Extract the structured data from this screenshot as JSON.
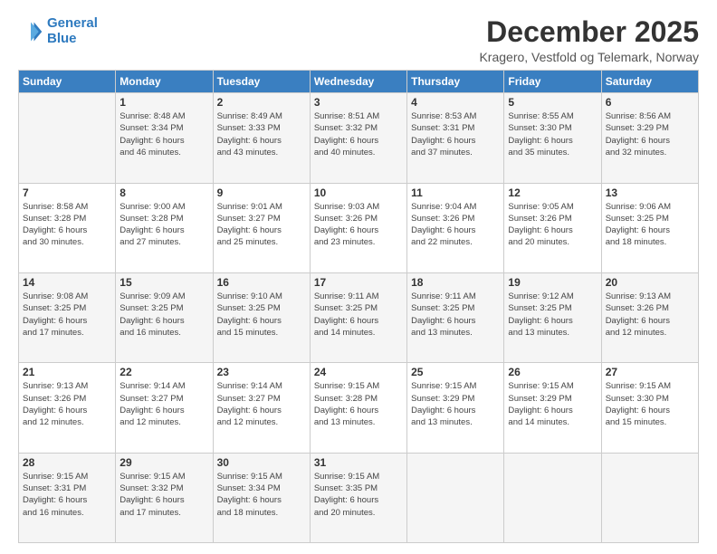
{
  "logo": {
    "line1": "General",
    "line2": "Blue"
  },
  "title": "December 2025",
  "subtitle": "Kragero, Vestfold og Telemark, Norway",
  "days_of_week": [
    "Sunday",
    "Monday",
    "Tuesday",
    "Wednesday",
    "Thursday",
    "Friday",
    "Saturday"
  ],
  "weeks": [
    [
      {
        "day": "",
        "info": ""
      },
      {
        "day": "1",
        "info": "Sunrise: 8:48 AM\nSunset: 3:34 PM\nDaylight: 6 hours\nand 46 minutes."
      },
      {
        "day": "2",
        "info": "Sunrise: 8:49 AM\nSunset: 3:33 PM\nDaylight: 6 hours\nand 43 minutes."
      },
      {
        "day": "3",
        "info": "Sunrise: 8:51 AM\nSunset: 3:32 PM\nDaylight: 6 hours\nand 40 minutes."
      },
      {
        "day": "4",
        "info": "Sunrise: 8:53 AM\nSunset: 3:31 PM\nDaylight: 6 hours\nand 37 minutes."
      },
      {
        "day": "5",
        "info": "Sunrise: 8:55 AM\nSunset: 3:30 PM\nDaylight: 6 hours\nand 35 minutes."
      },
      {
        "day": "6",
        "info": "Sunrise: 8:56 AM\nSunset: 3:29 PM\nDaylight: 6 hours\nand 32 minutes."
      }
    ],
    [
      {
        "day": "7",
        "info": "Sunrise: 8:58 AM\nSunset: 3:28 PM\nDaylight: 6 hours\nand 30 minutes."
      },
      {
        "day": "8",
        "info": "Sunrise: 9:00 AM\nSunset: 3:28 PM\nDaylight: 6 hours\nand 27 minutes."
      },
      {
        "day": "9",
        "info": "Sunrise: 9:01 AM\nSunset: 3:27 PM\nDaylight: 6 hours\nand 25 minutes."
      },
      {
        "day": "10",
        "info": "Sunrise: 9:03 AM\nSunset: 3:26 PM\nDaylight: 6 hours\nand 23 minutes."
      },
      {
        "day": "11",
        "info": "Sunrise: 9:04 AM\nSunset: 3:26 PM\nDaylight: 6 hours\nand 22 minutes."
      },
      {
        "day": "12",
        "info": "Sunrise: 9:05 AM\nSunset: 3:26 PM\nDaylight: 6 hours\nand 20 minutes."
      },
      {
        "day": "13",
        "info": "Sunrise: 9:06 AM\nSunset: 3:25 PM\nDaylight: 6 hours\nand 18 minutes."
      }
    ],
    [
      {
        "day": "14",
        "info": "Sunrise: 9:08 AM\nSunset: 3:25 PM\nDaylight: 6 hours\nand 17 minutes."
      },
      {
        "day": "15",
        "info": "Sunrise: 9:09 AM\nSunset: 3:25 PM\nDaylight: 6 hours\nand 16 minutes."
      },
      {
        "day": "16",
        "info": "Sunrise: 9:10 AM\nSunset: 3:25 PM\nDaylight: 6 hours\nand 15 minutes."
      },
      {
        "day": "17",
        "info": "Sunrise: 9:11 AM\nSunset: 3:25 PM\nDaylight: 6 hours\nand 14 minutes."
      },
      {
        "day": "18",
        "info": "Sunrise: 9:11 AM\nSunset: 3:25 PM\nDaylight: 6 hours\nand 13 minutes."
      },
      {
        "day": "19",
        "info": "Sunrise: 9:12 AM\nSunset: 3:25 PM\nDaylight: 6 hours\nand 13 minutes."
      },
      {
        "day": "20",
        "info": "Sunrise: 9:13 AM\nSunset: 3:26 PM\nDaylight: 6 hours\nand 12 minutes."
      }
    ],
    [
      {
        "day": "21",
        "info": "Sunrise: 9:13 AM\nSunset: 3:26 PM\nDaylight: 6 hours\nand 12 minutes."
      },
      {
        "day": "22",
        "info": "Sunrise: 9:14 AM\nSunset: 3:27 PM\nDaylight: 6 hours\nand 12 minutes."
      },
      {
        "day": "23",
        "info": "Sunrise: 9:14 AM\nSunset: 3:27 PM\nDaylight: 6 hours\nand 12 minutes."
      },
      {
        "day": "24",
        "info": "Sunrise: 9:15 AM\nSunset: 3:28 PM\nDaylight: 6 hours\nand 13 minutes."
      },
      {
        "day": "25",
        "info": "Sunrise: 9:15 AM\nSunset: 3:29 PM\nDaylight: 6 hours\nand 13 minutes."
      },
      {
        "day": "26",
        "info": "Sunrise: 9:15 AM\nSunset: 3:29 PM\nDaylight: 6 hours\nand 14 minutes."
      },
      {
        "day": "27",
        "info": "Sunrise: 9:15 AM\nSunset: 3:30 PM\nDaylight: 6 hours\nand 15 minutes."
      }
    ],
    [
      {
        "day": "28",
        "info": "Sunrise: 9:15 AM\nSunset: 3:31 PM\nDaylight: 6 hours\nand 16 minutes."
      },
      {
        "day": "29",
        "info": "Sunrise: 9:15 AM\nSunset: 3:32 PM\nDaylight: 6 hours\nand 17 minutes."
      },
      {
        "day": "30",
        "info": "Sunrise: 9:15 AM\nSunset: 3:34 PM\nDaylight: 6 hours\nand 18 minutes."
      },
      {
        "day": "31",
        "info": "Sunrise: 9:15 AM\nSunset: 3:35 PM\nDaylight: 6 hours\nand 20 minutes."
      },
      {
        "day": "",
        "info": ""
      },
      {
        "day": "",
        "info": ""
      },
      {
        "day": "",
        "info": ""
      }
    ]
  ]
}
